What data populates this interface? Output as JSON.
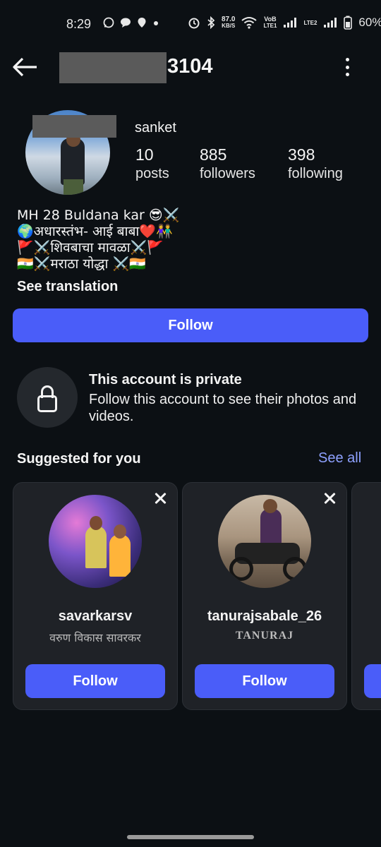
{
  "status_bar": {
    "time": "8:29",
    "left_icons": [
      "whatsapp-icon",
      "chat-icon",
      "location-icon",
      "dot-icon"
    ],
    "net_speed_value": "87.0",
    "net_speed_unit": "KB/S",
    "volte_label_1": "VoB",
    "volte_label_2": "LTE1",
    "volte_label_3": "LTE2",
    "battery": "60%"
  },
  "header": {
    "title_visible": "3104"
  },
  "profile": {
    "username": "sanket",
    "posts_count": "10",
    "posts_label": "posts",
    "followers_count": "885",
    "followers_label": "followers",
    "following_count": "398",
    "following_label": "following",
    "bio_lines": [
      "MH 28 Buldana kar 😎⚔️",
      "🌍अधारस्तंभ- आई बाबा❤️👫",
      "🚩⚔️शिवबाचा मावळा⚔️🚩",
      "🇮🇳⚔️मराठा योद्धा ⚔️🇮🇳"
    ],
    "see_translation": "See translation",
    "follow_label": "Follow"
  },
  "private": {
    "title": "This account is private",
    "description": "Follow this account to see their photos and videos."
  },
  "suggested": {
    "title": "Suggested for you",
    "see_all": "See all",
    "cards": [
      {
        "username": "savarkarsv",
        "subtitle": "वरुण विकास सावरकर",
        "follow_label": "Follow"
      },
      {
        "username": "tanurajsabale_26",
        "subtitle": "TANURAJ",
        "follow_label": "Follow"
      }
    ]
  },
  "colors": {
    "background": "#0c1014",
    "accent": "#4a5df9",
    "link": "#8ea1ff",
    "card": "#1f2227"
  }
}
